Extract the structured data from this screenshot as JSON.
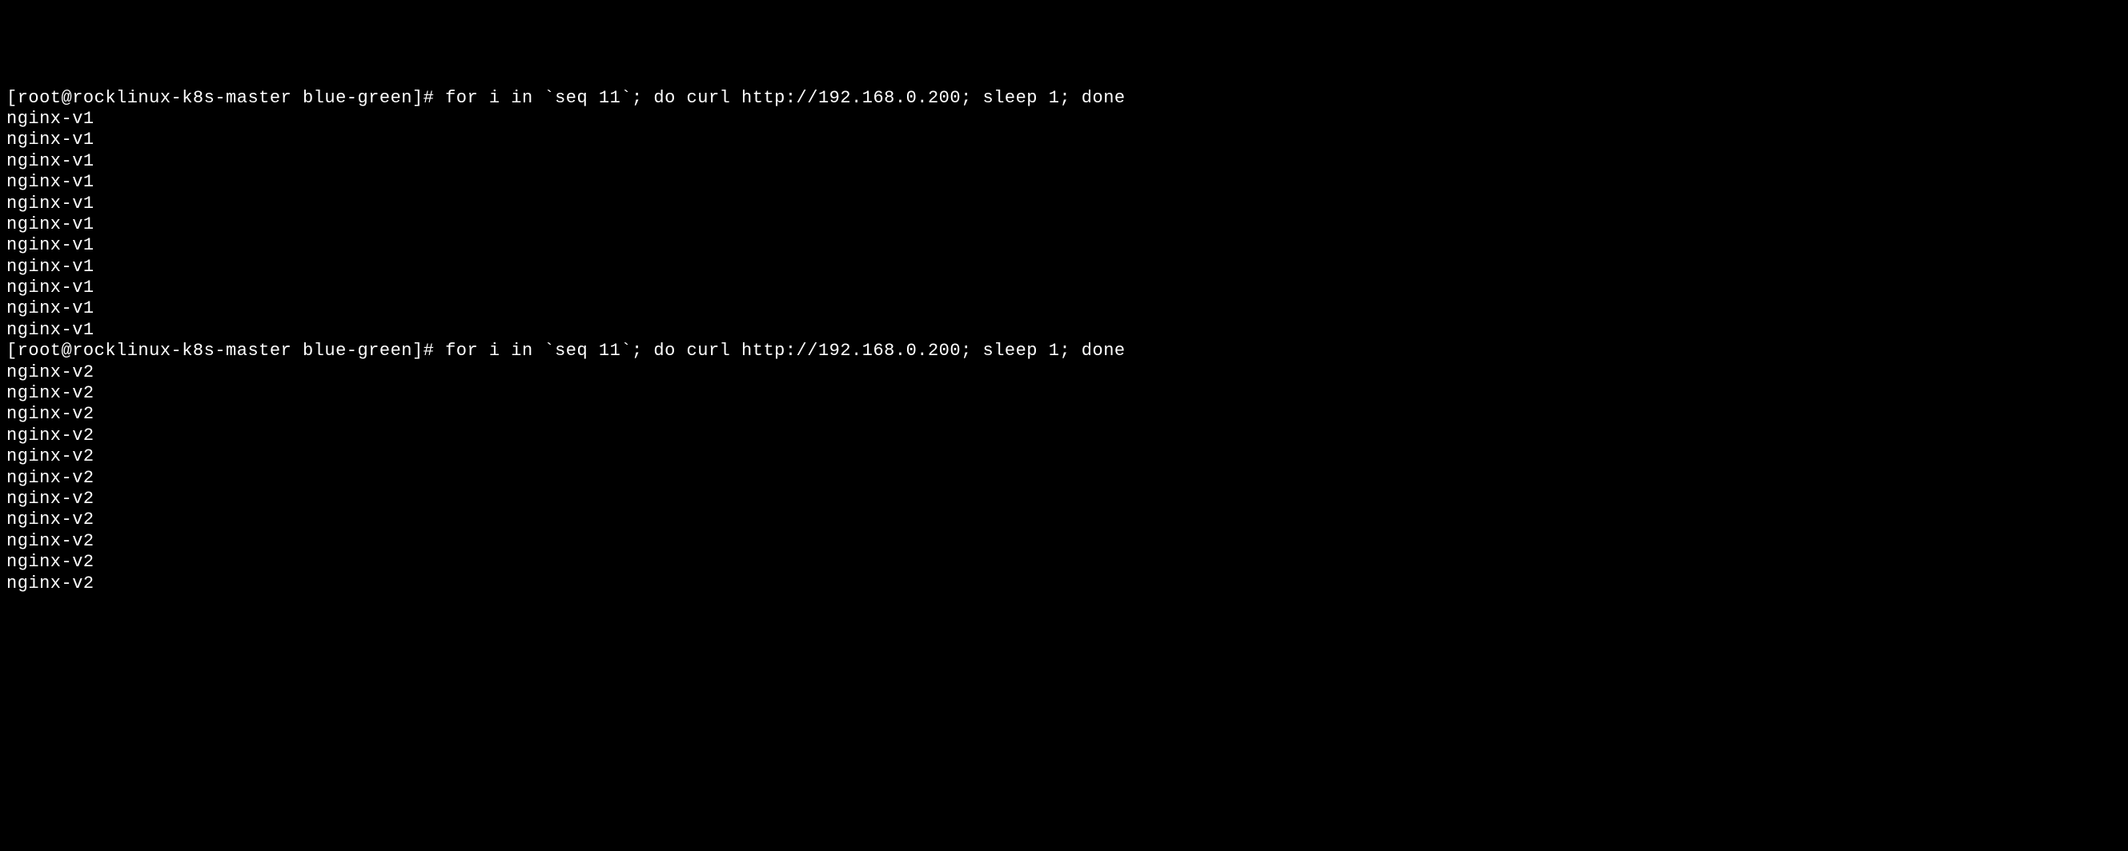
{
  "terminal": {
    "lines": [
      "[root@rocklinux-k8s-master blue-green]# for i in `seq 11`; do curl http://192.168.0.200; sleep 1; done",
      "nginx-v1",
      "nginx-v1",
      "nginx-v1",
      "nginx-v1",
      "nginx-v1",
      "nginx-v1",
      "nginx-v1",
      "nginx-v1",
      "nginx-v1",
      "nginx-v1",
      "nginx-v1",
      "[root@rocklinux-k8s-master blue-green]# for i in `seq 11`; do curl http://192.168.0.200; sleep 1; done",
      "nginx-v2",
      "nginx-v2",
      "nginx-v2",
      "nginx-v2",
      "nginx-v2",
      "nginx-v2",
      "nginx-v2",
      "nginx-v2",
      "nginx-v2",
      "nginx-v2",
      "nginx-v2"
    ]
  }
}
